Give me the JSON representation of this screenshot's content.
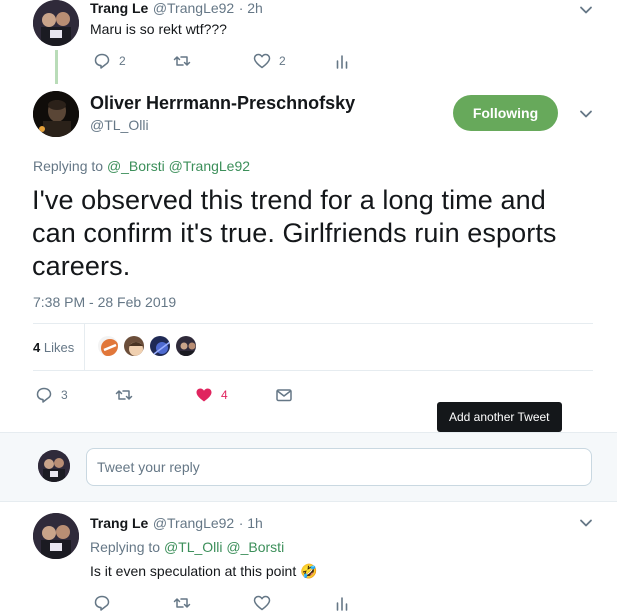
{
  "top_tweet": {
    "author_name": "Trang Le",
    "author_handle": "@TrangLe92",
    "time": "· 2h",
    "text": "Maru is so rekt wtf???",
    "reply_count": "2",
    "like_count": "2"
  },
  "main_tweet": {
    "author_name": "Oliver Herrmann-Preschnofsky",
    "author_handle": "@TL_Olli",
    "follow_label": "Following",
    "replying_prefix": "Replying to",
    "replying_handles": [
      "@_Borsti",
      "@TrangLe92"
    ],
    "text": "I've observed this trend for a long time and can confirm it's true. Girlfriends ruin esports careers.",
    "timestamp": "7:38 PM - 28 Feb 2019",
    "likes_count": "4",
    "likes_label": "Likes",
    "reply_count": "3",
    "heart_count": "4",
    "colors": {
      "heart": "#e0245e",
      "follow_bg": "#67a95b",
      "link": "#3c8f5a"
    }
  },
  "tooltip": {
    "label": "Add another Tweet"
  },
  "reply_composer": {
    "placeholder": "Tweet your reply"
  },
  "bottom_tweet": {
    "author_name": "Trang Le",
    "author_handle": "@TrangLe92",
    "time": "· 1h",
    "replying_prefix": "Replying to",
    "replying_handles": [
      "@TL_Olli",
      "@_Borsti"
    ],
    "text": "Is it even speculation at this point",
    "emoji": "🤣"
  },
  "icons": [
    "chevron-down-icon",
    "reply-icon",
    "retweet-icon",
    "heart-icon",
    "analytics-icon",
    "message-icon"
  ]
}
